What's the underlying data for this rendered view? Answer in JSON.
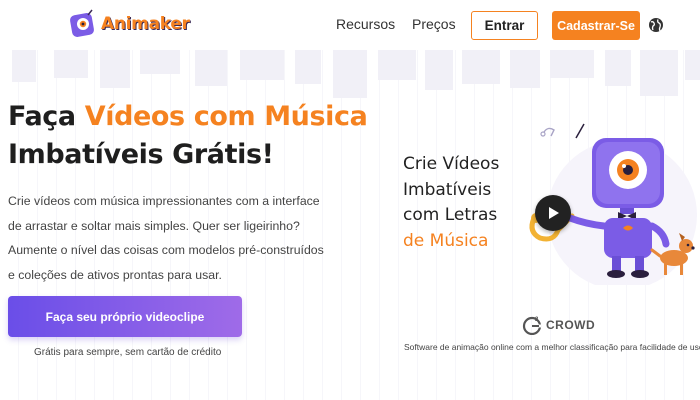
{
  "header": {
    "logo_text": "Animaker",
    "nav": [
      "Recursos",
      "Preços"
    ],
    "login_label": "Entrar",
    "signup_label": "Cadastrar-Se",
    "language_icon": "globe-icon"
  },
  "hero": {
    "title_line1_plain": "Faça ",
    "title_line1_accent": "Vídeos com Música",
    "title_line2": "Imbatíveis Grátis!",
    "description": "Crie vídeos com música impressionantes com a interface de arrastar e soltar mais simples. Quer ser ligeirinho? Aumente o nível das coisas com modelos pré-construídos e coleções de ativos prontas para usar.",
    "cta_label": "Faça seu próprio videoclipe",
    "cta_note": "Grátis para sempre, sem cartão de crédito"
  },
  "panel": {
    "line1": "Crie Vídeos",
    "line2": "Imbatíveis",
    "line3": "com Letras",
    "line4_accent": "de Música",
    "play_icon": "play-icon"
  },
  "rating": {
    "brand": "CROWD",
    "note": "Software de animação online com a melhor classificação para facilidade de uso"
  },
  "colors": {
    "accent": "#f58220",
    "cta_start": "#6a4ee8",
    "cta_end": "#9f6be8",
    "robot_purple": "#7b5ce6"
  }
}
